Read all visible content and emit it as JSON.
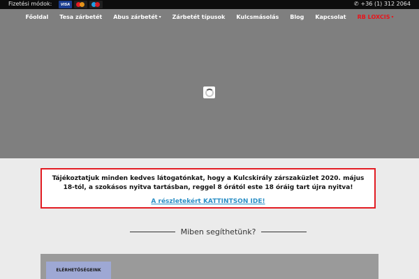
{
  "topbar": {
    "payment_label": "Fizetési módok:",
    "cards": [
      {
        "name": "visa",
        "label": "VISA"
      },
      {
        "name": "mastercard",
        "label": ""
      },
      {
        "name": "maestro",
        "label": ""
      }
    ],
    "phone_icon": "phone-icon",
    "phone": "+36 (1) 312 2064"
  },
  "nav": {
    "items": [
      {
        "label": "Főoldal"
      },
      {
        "label": "Tesa zárbetét"
      },
      {
        "label": "Abus zárbetét",
        "caret": "▾"
      },
      {
        "label": "Zárbetét típusok"
      },
      {
        "label": "Kulcsmásolás"
      },
      {
        "label": "Blog"
      },
      {
        "label": "Kapcsolat"
      },
      {
        "label": "RB LOXCIS",
        "caret": "▾"
      }
    ]
  },
  "hero": {
    "spinner_icon": "loading-spinner-icon"
  },
  "notice": {
    "text": "Tájékoztatjuk minden kedves látogatónkat, hogy a Kulcskirály zárszaküzlet 2020. május 18-tól, a szokásos nyitva tartásban, reggel 8 órától este 18 óráig tart újra nyitva!",
    "link": "A részletekért KATTINTSON IDE!",
    "border_color": "#e21b22",
    "link_color": "#2b8fc6"
  },
  "help": {
    "title": "Miben segíthetünk?"
  },
  "panel": {
    "contact_tab": "ELÉRHETŐSÉGEINK"
  }
}
